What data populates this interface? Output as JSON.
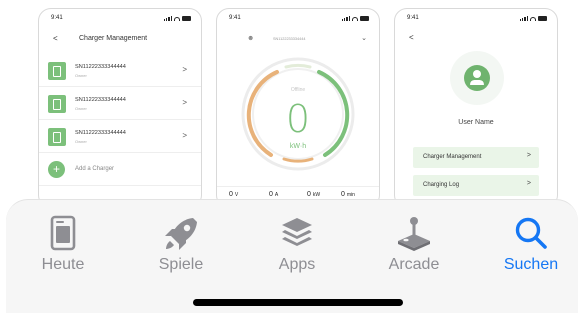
{
  "screens": {
    "status_time": "9:41",
    "charger_management": {
      "title": "Charger Management",
      "chargers": [
        {
          "serial": "SN11222333344444",
          "role": "Owner"
        },
        {
          "serial": "SN11222333344444",
          "role": "Owner"
        },
        {
          "serial": "SN11222333344444",
          "role": "Owner"
        }
      ],
      "add_label": "Add a Charger"
    },
    "dashboard": {
      "device_serial": "SN1122233334444",
      "status": "Offline",
      "energy_value": "0",
      "energy_unit": "kW·h",
      "stats": [
        {
          "value": "0",
          "unit": "V",
          "label": "Voltage"
        },
        {
          "value": "0",
          "unit": "A",
          "label": "Current"
        },
        {
          "value": "0",
          "unit": "kW",
          "label": "Power"
        },
        {
          "value": "0",
          "unit": "min",
          "label": "Time"
        }
      ],
      "ring_colors": {
        "left": "#e8b27a",
        "right": "#7cc07b"
      }
    },
    "profile": {
      "user_name": "User Name",
      "menu": [
        {
          "label": "Charger Management"
        },
        {
          "label": "Charging Log"
        }
      ]
    }
  },
  "tabbar": {
    "tabs": [
      {
        "label": "Heute",
        "icon": "today-icon",
        "active": false
      },
      {
        "label": "Spiele",
        "icon": "rocket-icon",
        "active": false
      },
      {
        "label": "Apps",
        "icon": "apps-stack-icon",
        "active": false
      },
      {
        "label": "Arcade",
        "icon": "joystick-icon",
        "active": false
      },
      {
        "label": "Suchen",
        "icon": "search-icon",
        "active": true
      }
    ],
    "active_color": "#1577f4",
    "inactive_color": "#8e8e93"
  }
}
